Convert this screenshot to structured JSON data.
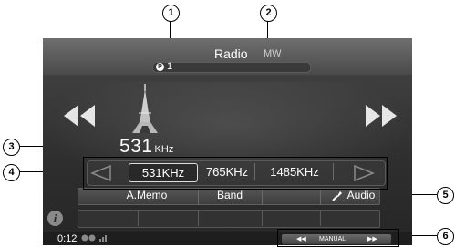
{
  "header": {
    "title": "Radio",
    "band": "MW",
    "preset_badge": "P",
    "preset_number": "1"
  },
  "station": {
    "frequency_value": "531",
    "frequency_unit": "KHz"
  },
  "presets": [
    {
      "label": "531KHz",
      "selected": true
    },
    {
      "label": "765KHz",
      "selected": false
    },
    {
      "label": "1485KHz",
      "selected": false
    }
  ],
  "functions": {
    "memo": "A.Memo",
    "band": "Band",
    "audio": "Audio"
  },
  "info_icon_glyph": "i",
  "status": {
    "time": "0:12"
  },
  "seek": {
    "mode_label": "MANUAL"
  },
  "callouts": [
    "1",
    "2",
    "3",
    "4",
    "5",
    "6"
  ],
  "icons": {
    "rewind": "rewind-icon",
    "forward": "fast-forward-icon",
    "tower": "radio-tower-icon",
    "left": "preset-left-icon",
    "right": "preset-right-icon",
    "wrench": "wrench-icon",
    "info": "info-icon",
    "status": "connection-status-icons"
  }
}
